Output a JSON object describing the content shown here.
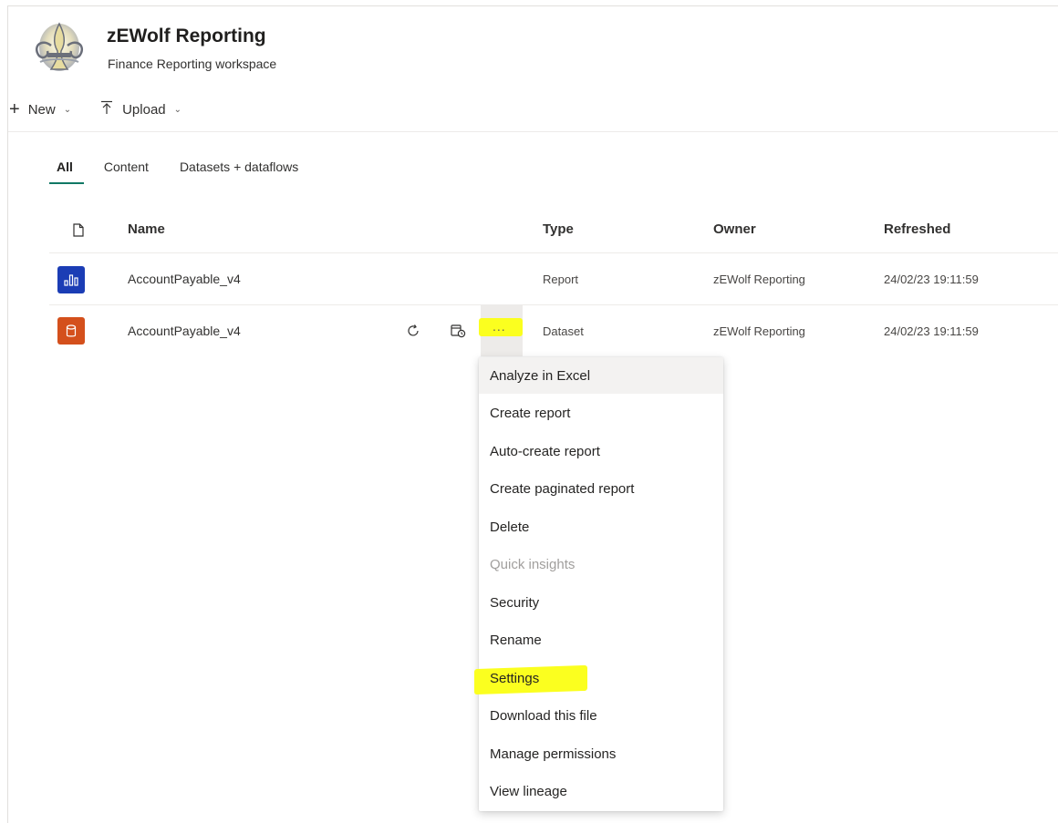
{
  "workspace": {
    "title": "zEWolf Reporting",
    "subtitle": "Finance Reporting workspace"
  },
  "toolbar": {
    "new_label": "New",
    "upload_label": "Upload"
  },
  "tabs": [
    {
      "label": "All",
      "active": true
    },
    {
      "label": "Content",
      "active": false
    },
    {
      "label": "Datasets + dataflows",
      "active": false
    }
  ],
  "table": {
    "headers": {
      "name": "Name",
      "type": "Type",
      "owner": "Owner",
      "refreshed": "Refreshed"
    },
    "rows": [
      {
        "name": "AccountPayable_v4",
        "type": "Report",
        "owner": "zEWolf Reporting",
        "refreshed": "24/02/23 19:11:59",
        "icon": "report-icon",
        "icon_color": "#1b3db5"
      },
      {
        "name": "AccountPayable_v4",
        "type": "Dataset",
        "owner": "zEWolf Reporting",
        "refreshed": "24/02/23 19:11:59",
        "icon": "dataset-icon",
        "icon_color": "#d4501c"
      }
    ],
    "more_label": "..."
  },
  "context_menu": {
    "items": [
      {
        "label": "Analyze in Excel",
        "disabled": false
      },
      {
        "label": "Create report",
        "disabled": false
      },
      {
        "label": "Auto-create report",
        "disabled": false
      },
      {
        "label": "Create paginated report",
        "disabled": false
      },
      {
        "label": "Delete",
        "disabled": false
      },
      {
        "label": "Quick insights",
        "disabled": true
      },
      {
        "label": "Security",
        "disabled": false
      },
      {
        "label": "Rename",
        "disabled": false
      },
      {
        "label": "Settings",
        "disabled": false,
        "highlighted": true
      },
      {
        "label": "Download this file",
        "disabled": false
      },
      {
        "label": "Manage permissions",
        "disabled": false
      },
      {
        "label": "View lineage",
        "disabled": false
      }
    ]
  },
  "colors": {
    "accent": "#117865",
    "highlight": "#fbff1f",
    "report_icon": "#1b3db5",
    "dataset_icon": "#d4501c"
  }
}
